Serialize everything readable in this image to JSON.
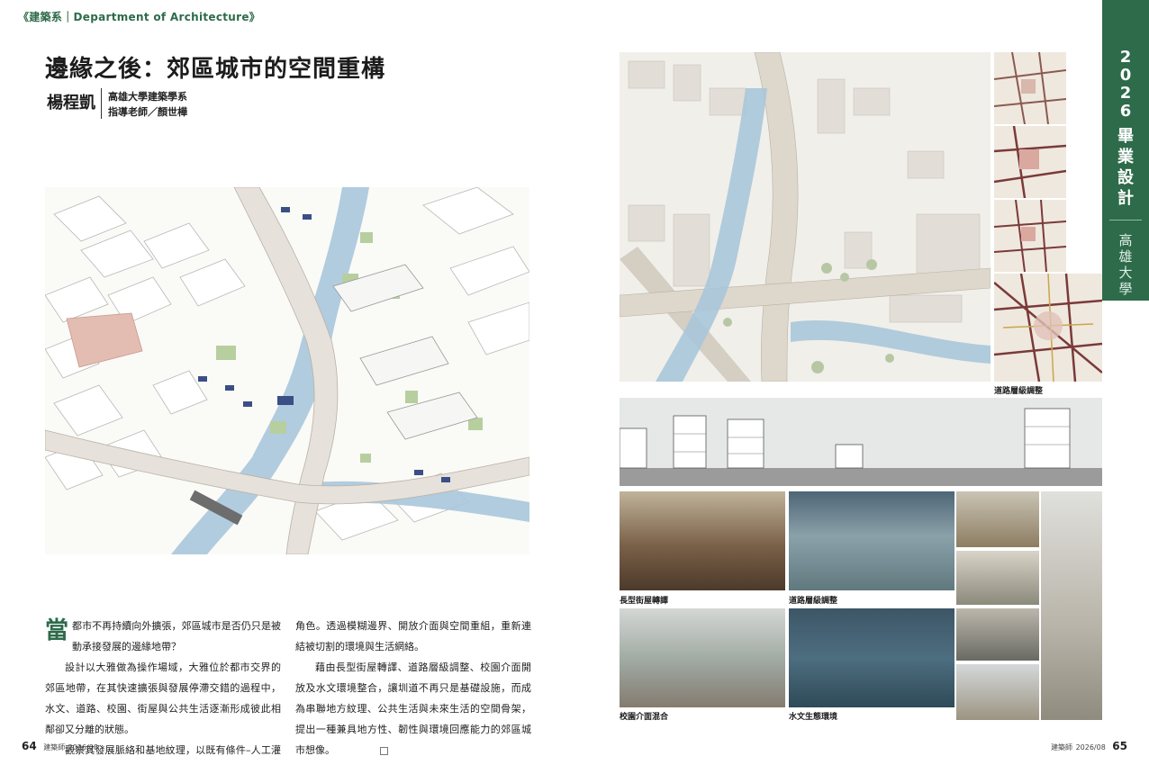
{
  "left_page": {
    "section_tag": "《建築系｜Department of Architecture》",
    "title": "邊緣之後：郊區城市的空間重構",
    "author": "楊程凱",
    "affiliation": "高雄大學建築學系",
    "advisor": "指導老師／顏世樺",
    "body": {
      "dropcap": "當",
      "p1": "都市不再持續向外擴張，郊區城市是否仍只是被動承接發展的邊緣地帶？",
      "p2": "設計以大雅做為操作場域，大雅位於都市交界的郊區地帶，在其快速擴張與發展停滯交錯的過程中，水文、道路、校園、街屋與公共生活逐漸形成彼此相鄰卻又分離的狀態。",
      "p3": "觀察其發展脈絡和基地紋理，以既有條件–人工灌溉水圳作為重新理解城市的起點，思考郊區城市的空間價值與未來",
      "p4": "角色。透過模糊邊界、開放介面與空間重組，重新連結被切割的環境與生活網絡。",
      "p5": "藉由長型街屋轉譯、道路層級調整、校園介面開放及水文環境整合，讓圳道不再只是基礎設施，而成為串聯地方紋理、公共生活與未來生活的空間骨架，提出一種兼具地方性、韌性與環境回應能力的郊區城市想像。"
    },
    "folio": {
      "number": "64",
      "magazine": "建築師",
      "date": "2026/08"
    }
  },
  "right_page": {
    "captions": {
      "road_hierarchy": "道路層級調整",
      "street_house": "長型街屋轉譯",
      "road_hierarchy_2": "道路層級調整",
      "campus_interface": "校園介面混合",
      "water_env": "水文生態環境"
    },
    "folio": {
      "number": "65",
      "magazine": "建築師",
      "date": "2026/08"
    }
  },
  "side_tab": {
    "year_chars": [
      "2",
      "0",
      "2",
      "6"
    ],
    "label_chars": [
      "畢",
      "業",
      "設",
      "計"
    ],
    "school_chars": [
      "高",
      "雄",
      "大",
      "學"
    ]
  },
  "colors": {
    "accent_green": "#2d6b4a",
    "canal_blue": "#a9c6da",
    "pink_block": "#e3bcb2"
  }
}
